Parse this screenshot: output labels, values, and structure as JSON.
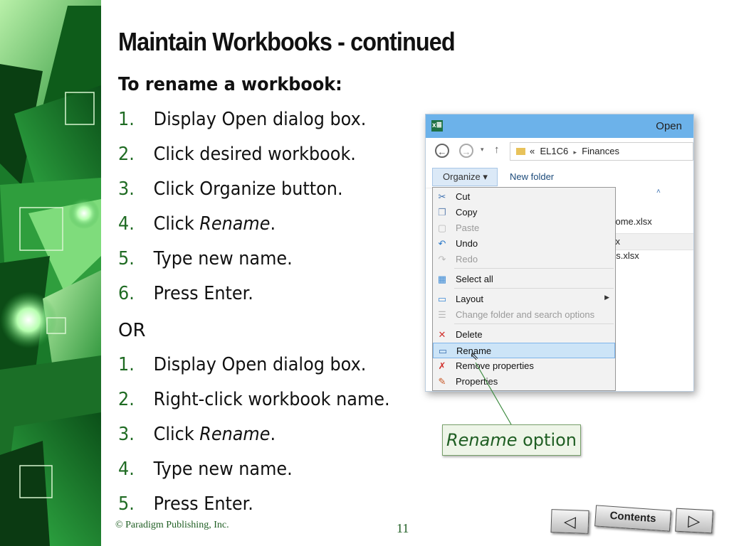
{
  "slide": {
    "title": "Maintain Workbooks - continued",
    "subheading": "To rename a workbook:",
    "steps_a": [
      {
        "num": "1.",
        "text": "Display Open dialog box."
      },
      {
        "num": "2.",
        "text": "Click desired workbook."
      },
      {
        "num": "3.",
        "text": "Click Organize button."
      },
      {
        "num": "4.",
        "pre": "Click ",
        "italic": "Rename",
        "post": "."
      },
      {
        "num": "5.",
        "text": "Type new name."
      },
      {
        "num": "6.",
        "text": "Press Enter."
      }
    ],
    "or_label": "OR",
    "steps_b": [
      {
        "num": "1.",
        "text": "Display Open dialog box."
      },
      {
        "num": "2.",
        "text": "Right-click workbook name."
      },
      {
        "num": "3.",
        "pre": "Click ",
        "italic": "Rename",
        "post": "."
      },
      {
        "num": "4.",
        "text": "Type new name."
      },
      {
        "num": "5.",
        "text": "Press Enter."
      }
    ]
  },
  "dialog": {
    "app_icon": "x≣",
    "title": "Open",
    "breadcrumb_prefix": "«",
    "breadcrumb_folder": "EL1C6",
    "breadcrumb_sep": "▸",
    "breadcrumb_sub": "Finances",
    "organize_label": "Organize ▾",
    "new_folder_label": "New folder",
    "file_fragments": [
      "come.xlsx",
      "sx",
      "es.xlsx"
    ],
    "menu_items": [
      {
        "label": "Cut",
        "icon": "scissors-icon",
        "glyph": "✂",
        "color": "#3a6fb0",
        "disabled": false
      },
      {
        "label": "Copy",
        "icon": "copy-icon",
        "glyph": "❐",
        "color": "#6b8bb5",
        "disabled": false
      },
      {
        "label": "Paste",
        "icon": "paste-icon",
        "glyph": "▢",
        "color": "#b9b9b9",
        "disabled": true
      },
      {
        "label": "Undo",
        "icon": "undo-icon",
        "glyph": "↶",
        "color": "#2a78c8",
        "disabled": false
      },
      {
        "label": "Redo",
        "icon": "redo-icon",
        "glyph": "↷",
        "color": "#b9b9b9",
        "disabled": true
      },
      {
        "label": "Select all",
        "icon": "select-all-icon",
        "glyph": "▦",
        "color": "#3b8ad6",
        "disabled": false
      },
      {
        "label": "Layout",
        "icon": "layout-icon",
        "glyph": "▭",
        "color": "#3b8ad6",
        "disabled": false
      },
      {
        "label": "Change folder and search options",
        "icon": "folder-options-icon",
        "glyph": "☰",
        "color": "#b9b9b9",
        "disabled": true
      },
      {
        "label": "Delete",
        "icon": "delete-icon",
        "glyph": "✕",
        "color": "#d0312d",
        "disabled": false
      },
      {
        "label": "Rename",
        "icon": "rename-icon",
        "glyph": "▭",
        "color": "#3a6fb0",
        "disabled": false,
        "selected": true
      },
      {
        "label": "Remove properties",
        "icon": "remove-properties-icon",
        "glyph": "✗",
        "color": "#d0312d",
        "disabled": false
      },
      {
        "label": "Properties",
        "icon": "properties-icon",
        "glyph": "✎",
        "color": "#c85a2a",
        "disabled": false
      }
    ]
  },
  "callout": {
    "italic": "Rename",
    "text": " option"
  },
  "footer": {
    "copyright": "© Paradigm Publishing, Inc.",
    "page": "11"
  },
  "nav": {
    "prev_icon": "◁",
    "contents_label": "Contents",
    "next_icon": "▷"
  },
  "colors": {
    "accent_green": "#1f6b23",
    "titlebar_blue": "#6cb2ea"
  }
}
